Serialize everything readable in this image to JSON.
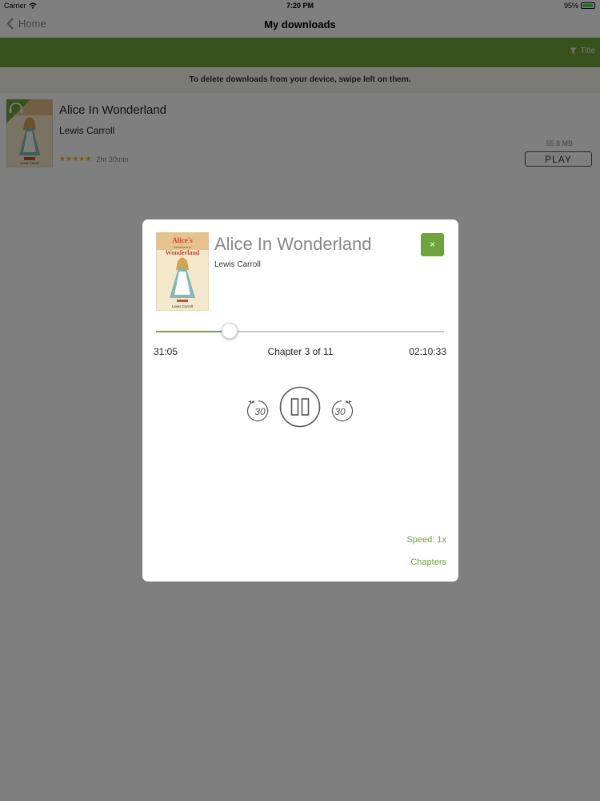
{
  "status_bar": {
    "carrier": "Carrier",
    "time": "7:20 PM",
    "battery": "95%",
    "battery_level": 0.95
  },
  "nav": {
    "back_label": "Home",
    "title": "My downloads"
  },
  "filter": {
    "sort_label": "Title"
  },
  "hint": "To delete downloads from your device, swipe left on them.",
  "download": {
    "title": "Alice In Wonderland",
    "author": "Lewis Carroll",
    "rating": 5,
    "stars": "★★★★★",
    "duration": "2hr 30min",
    "size": "55.8 MB",
    "play_label": "PLAY"
  },
  "cover": {
    "line1": "Alice's",
    "line2": "Adventures in",
    "line3": "Wonderland",
    "byline": "Lewis Carroll"
  },
  "player": {
    "title": "Alice In Wonderland",
    "author": "Lewis Carroll",
    "close_label": "×",
    "elapsed": "31:05",
    "chapter": "Chapter 3 of 11",
    "remaining": "02:10:33",
    "progress": 0.255,
    "skip_back": "30",
    "skip_forward": "30",
    "speed": "Speed: 1x",
    "chapters_label": "Chapters"
  },
  "colors": {
    "accent": "#6ea53a",
    "overlay": "rgba(0,0,0,0.5)",
    "star": "#e9b322"
  }
}
